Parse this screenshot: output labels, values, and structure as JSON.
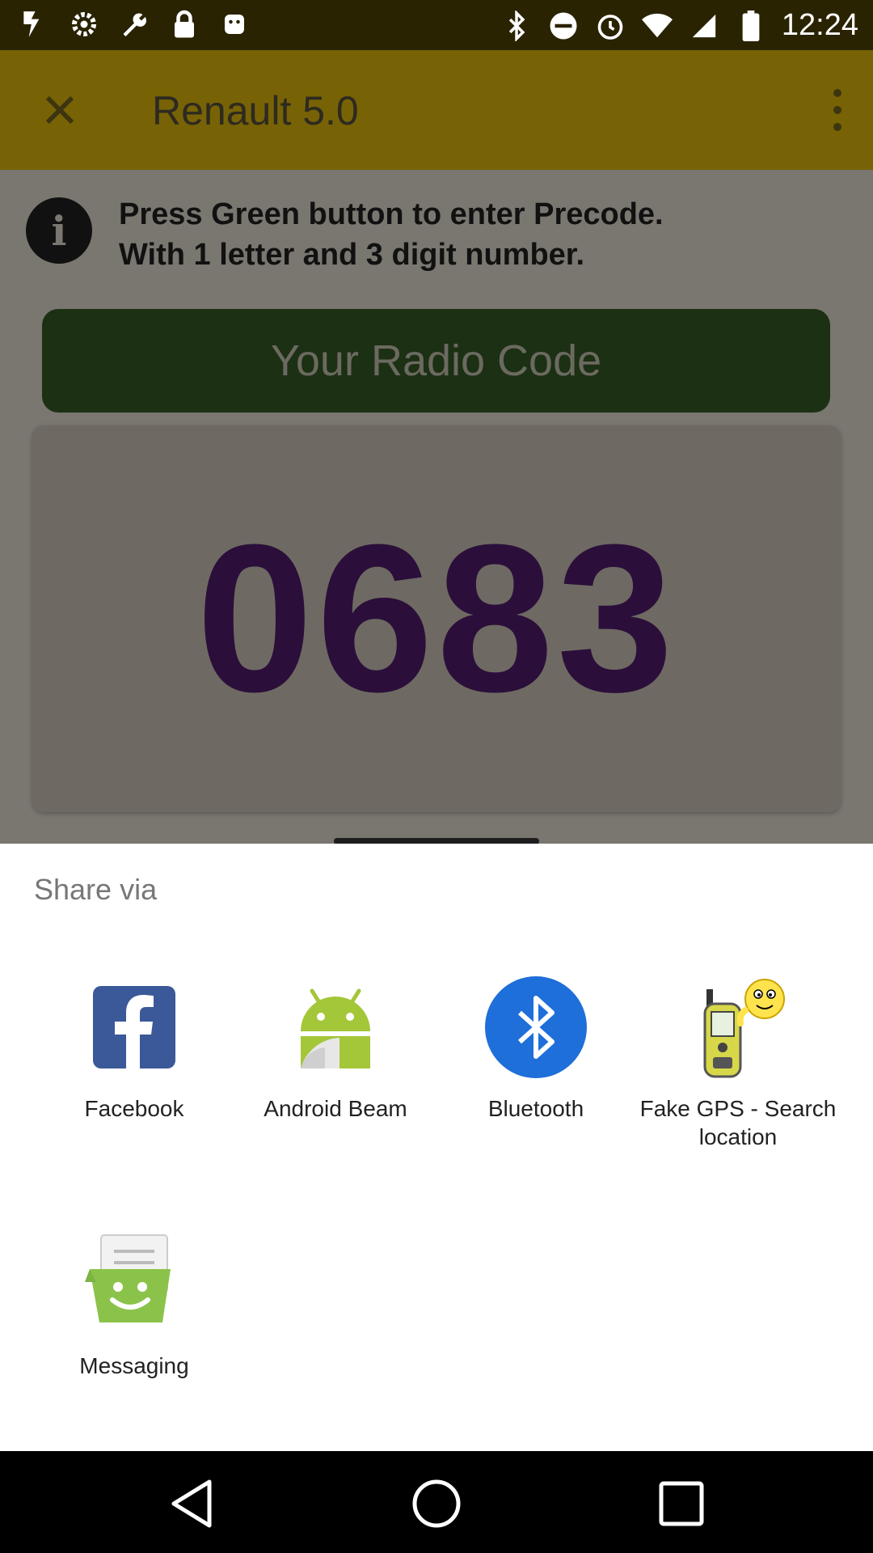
{
  "status_bar": {
    "time": "12:24",
    "left_icons": [
      "app-icon-1",
      "settings-icon",
      "wrench-icon",
      "lock-icon",
      "android-icon"
    ],
    "right_icons": [
      "bluetooth-icon",
      "do-not-disturb-icon",
      "alarm-icon",
      "wifi-icon",
      "signal-icon",
      "battery-icon"
    ]
  },
  "app_bar": {
    "title": "Renault 5.0"
  },
  "content": {
    "info_line1": "Press Green button to enter Precode.",
    "info_line2": "With 1 letter and 3 digit number.",
    "radio_button_label": "Your Radio Code",
    "code": "0683"
  },
  "share_sheet": {
    "title": "Share via",
    "apps": [
      {
        "label": "Facebook",
        "icon": "facebook-icon"
      },
      {
        "label": "Android Beam",
        "icon": "android-beam-icon"
      },
      {
        "label": "Bluetooth",
        "icon": "bluetooth-icon"
      },
      {
        "label": "Fake GPS - Search location",
        "icon": "fake-gps-icon"
      },
      {
        "label": "Messaging",
        "icon": "messaging-icon"
      }
    ]
  },
  "colors": {
    "facebook": "#3b5998",
    "android_green": "#a4c639",
    "bluetooth_blue": "#1e6fd9",
    "messaging_green": "#8bc34a"
  }
}
